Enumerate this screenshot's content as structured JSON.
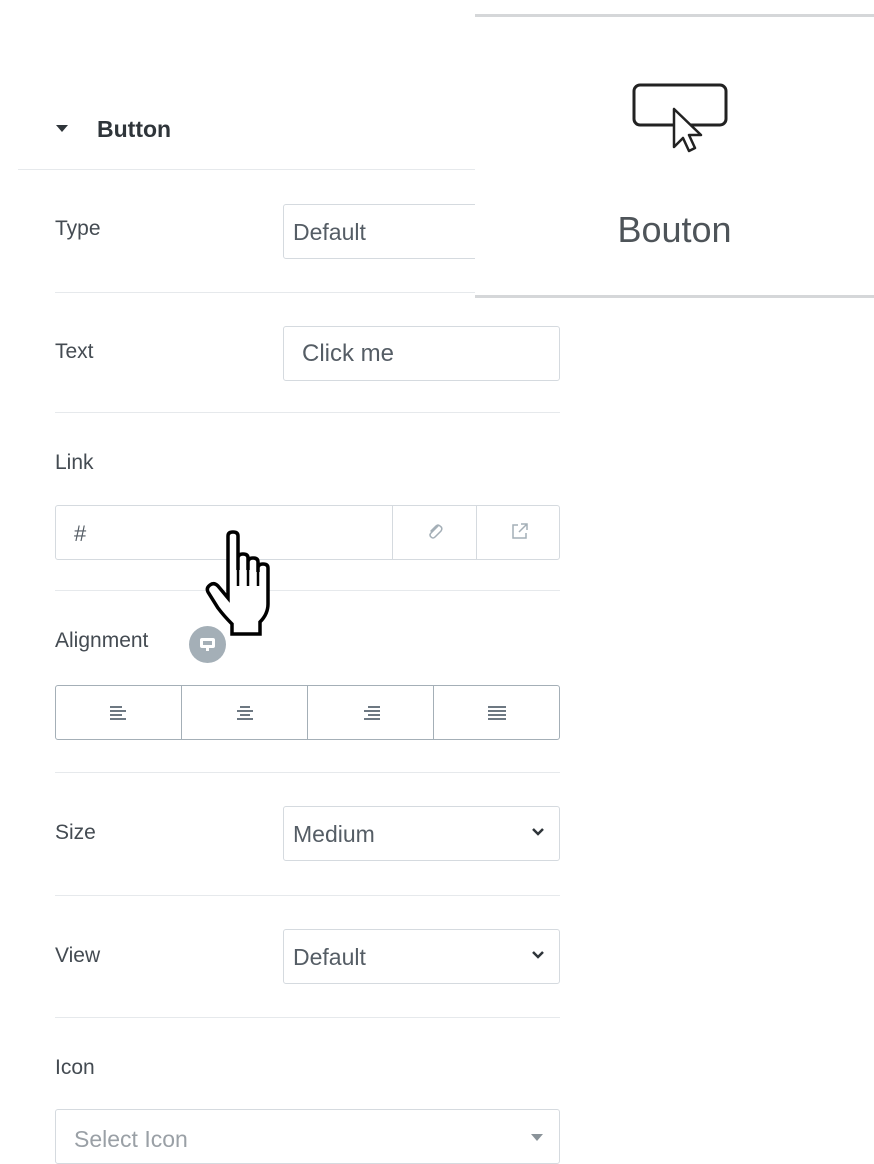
{
  "section": {
    "title": "Button"
  },
  "fields": {
    "type": {
      "label": "Type",
      "value": "Default"
    },
    "text": {
      "label": "Text",
      "value": "Click me"
    },
    "link": {
      "label": "Link",
      "value": "#"
    },
    "alignment": {
      "label": "Alignment",
      "options": [
        "left",
        "center",
        "right",
        "justify"
      ]
    },
    "size": {
      "label": "Size",
      "value": "Medium"
    },
    "view": {
      "label": "View",
      "value": "Default"
    },
    "icon": {
      "label": "Icon",
      "placeholder": "Select Icon"
    }
  },
  "widget_card": {
    "label": "Bouton",
    "icon": "button-cursor-icon"
  },
  "icons": {
    "section_toggle": "caret-down-icon",
    "link_options": "paperclip-icon",
    "link_new_tab": "external-link-icon",
    "responsive": "monitor-icon",
    "cursor": "hand-pointer-icon"
  },
  "colors": {
    "text": "#495157",
    "border": "#d5dadf",
    "badge": "#a4afb7"
  }
}
